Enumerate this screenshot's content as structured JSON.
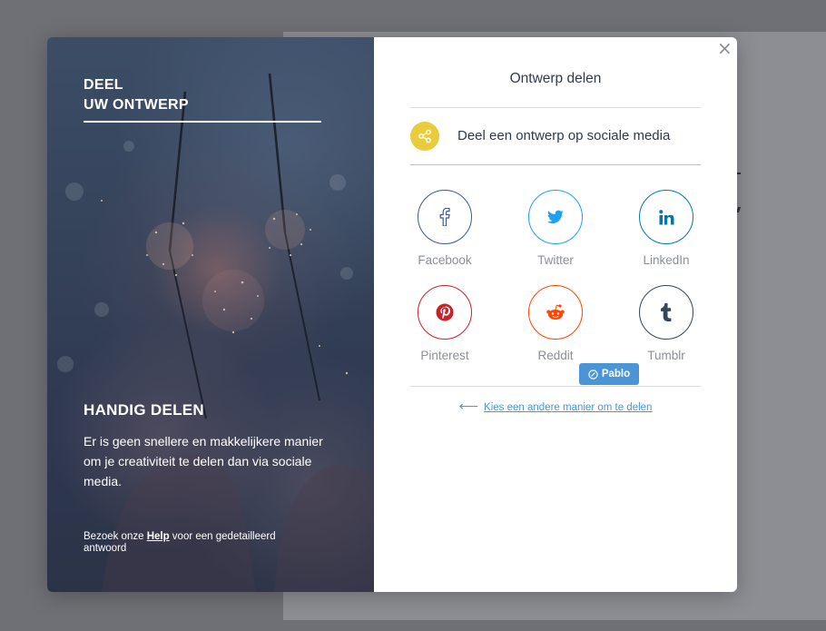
{
  "colors": {
    "accent_yellow": "#e8cc3c",
    "link_blue": "#4b95d6",
    "facebook": "#3b5998",
    "twitter": "#1da1f2",
    "linkedin": "#0077b5",
    "pinterest": "#cb2027",
    "reddit": "#ff4500",
    "tumblr": "#35465c"
  },
  "left": {
    "title_line1": "DEEL",
    "title_line2": "UW ONTWERP",
    "heading": "HANDIG DELEN",
    "body": "Er is geen snellere en makkelijkere manier om je creativiteit te delen dan via sociale media.",
    "footer_pre": "Bezoek onze ",
    "footer_link": "Help",
    "footer_post": " voor een gedetailleerd antwoord"
  },
  "right": {
    "close_label": "×",
    "title": "Ontwerp delen",
    "social_label": "Deel een ontwerp op sociale media",
    "social_icon": "share-icon",
    "networks": [
      {
        "label": "Facebook",
        "icon": "facebook-icon"
      },
      {
        "label": "Twitter",
        "icon": "twitter-icon"
      },
      {
        "label": "LinkedIn",
        "icon": "linkedin-icon"
      },
      {
        "label": "Pinterest",
        "icon": "pinterest-icon"
      },
      {
        "label": "Reddit",
        "icon": "reddit-icon"
      },
      {
        "label": "Tumblr",
        "icon": "tumblr-icon"
      }
    ],
    "pablo_label": "Pablo",
    "other_arrow": "⟵",
    "other_link": "Kies een andere manier om te delen"
  }
}
